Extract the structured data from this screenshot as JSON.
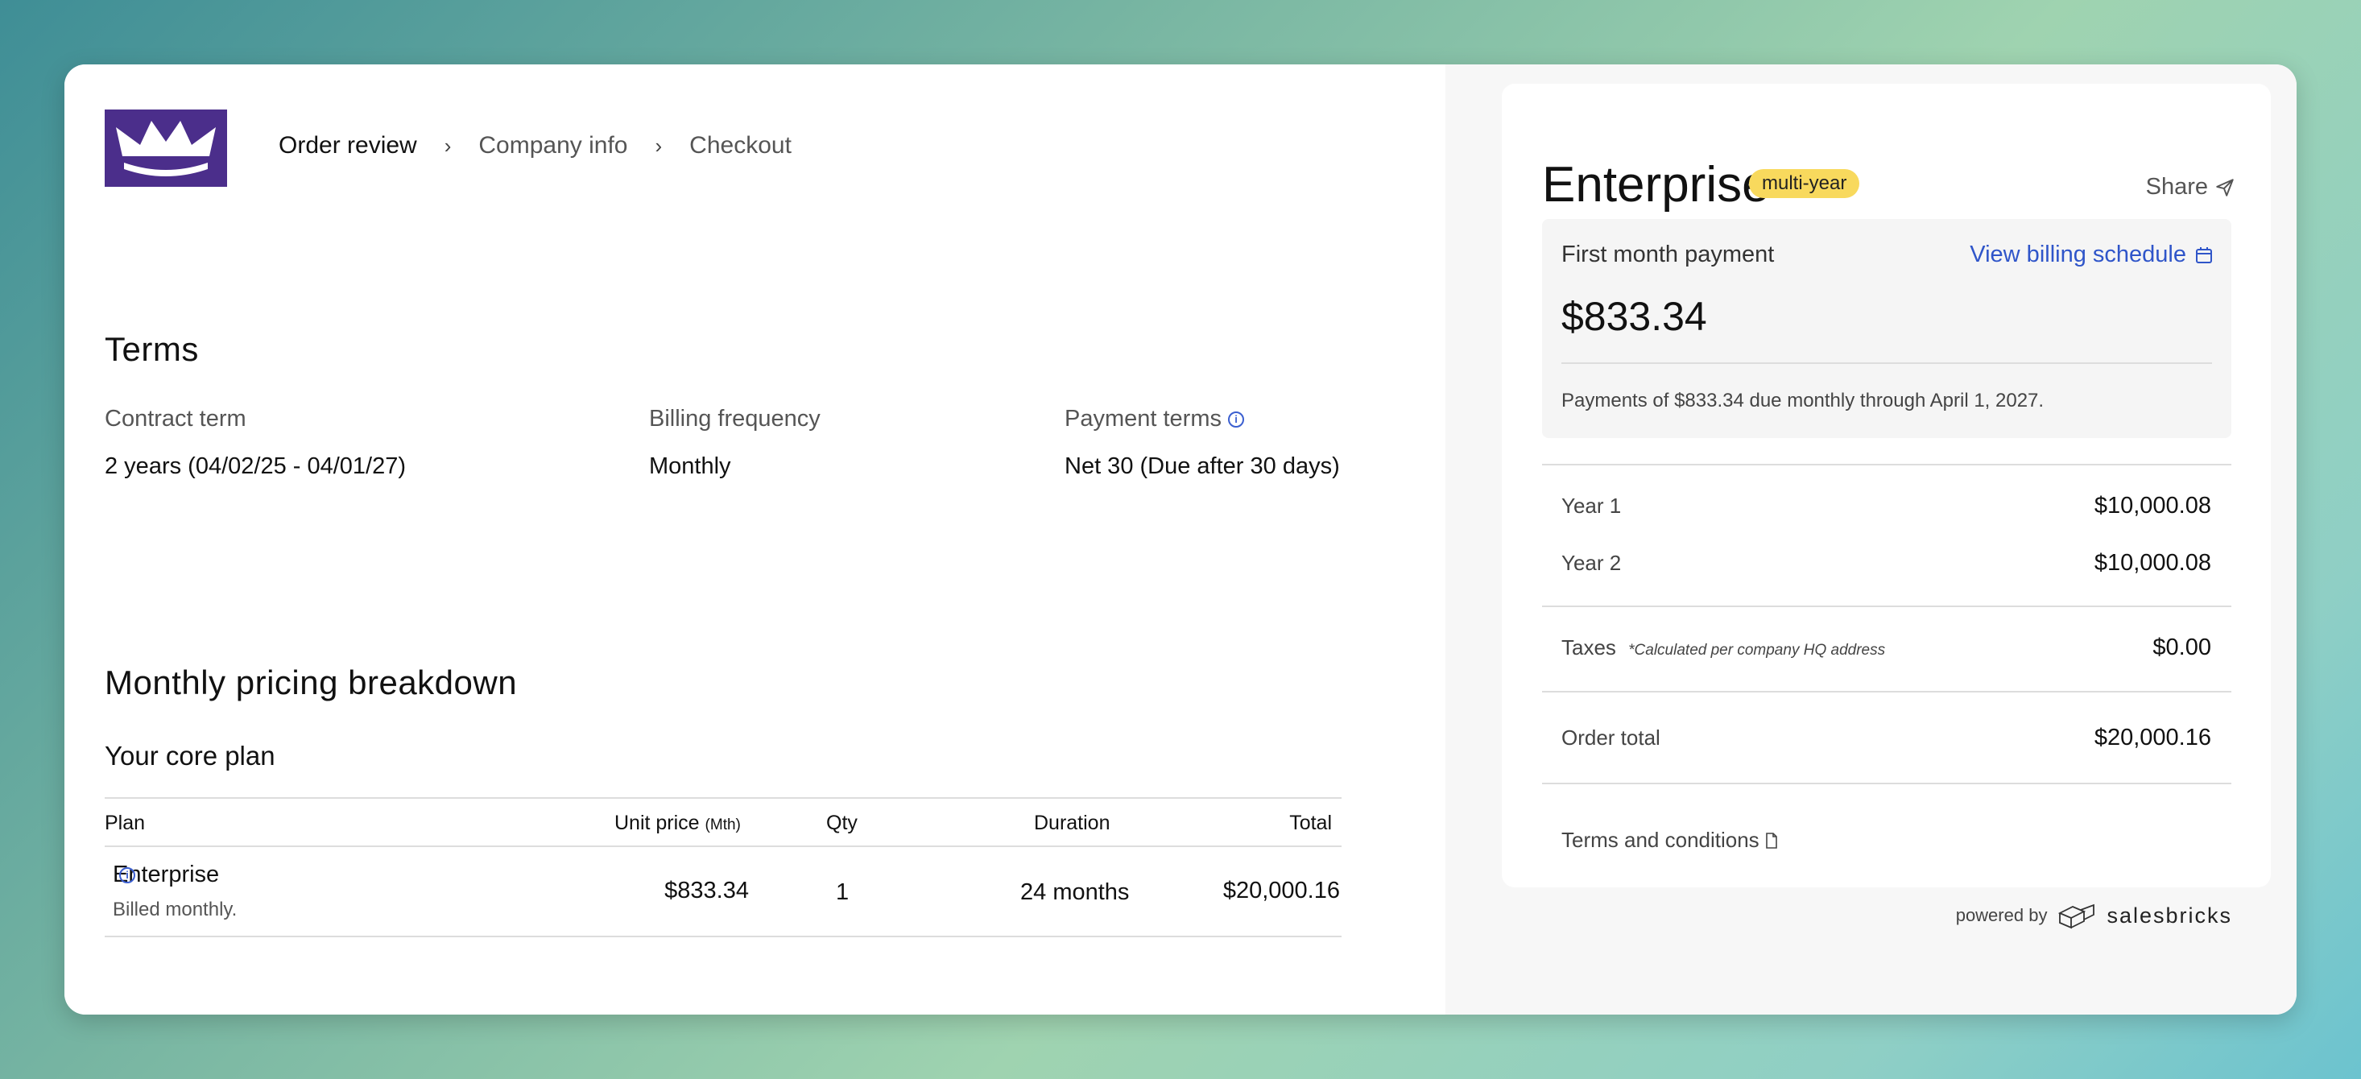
{
  "header": {
    "breadcrumb": [
      "Order review",
      "Company info",
      "Checkout"
    ]
  },
  "terms": {
    "title": "Terms",
    "contract_term_label": "Contract term",
    "contract_term_value": "2 years (04/02/25 - 04/01/27)",
    "billing_frequency_label": "Billing frequency",
    "billing_frequency_value": "Monthly",
    "payment_terms_label": "Payment terms",
    "payment_terms_value": "Net 30 (Due after 30 days)"
  },
  "pricing": {
    "title": "Monthly pricing breakdown",
    "core_plan_title": "Your core plan",
    "columns": {
      "plan": "Plan",
      "unit_price": "Unit price",
      "unit_price_suffix": "(Mth)",
      "qty": "Qty",
      "duration": "Duration",
      "total": "Total"
    },
    "row": {
      "plan": "Enterprise",
      "plan_note": "Billed monthly.",
      "unit_price": "$833.34",
      "qty": "1",
      "duration": "24 months",
      "total": "$20,000.16"
    }
  },
  "summary": {
    "title": "Enterprise",
    "badge": "multi-year",
    "share_label": "Share",
    "first_payment_label": "First month payment",
    "billing_schedule_link": "View billing schedule",
    "first_payment_amount": "$833.34",
    "payment_note": "Payments of $833.34 due monthly through April 1, 2027.",
    "years": [
      {
        "label": "Year 1",
        "amount": "$10,000.08"
      },
      {
        "label": "Year 2",
        "amount": "$10,000.08"
      }
    ],
    "taxes_label": "Taxes",
    "taxes_note": "*Calculated per company HQ address",
    "taxes_amount": "$0.00",
    "order_total_label": "Order total",
    "order_total_amount": "$20,000.16",
    "terms_link": "Terms and conditions"
  },
  "footer": {
    "powered_by": "powered by",
    "brand": "salesbricks"
  },
  "colors": {
    "logo_bg": "#4b2e8b",
    "link": "#2f55c9",
    "badge": "#f8d95d"
  }
}
